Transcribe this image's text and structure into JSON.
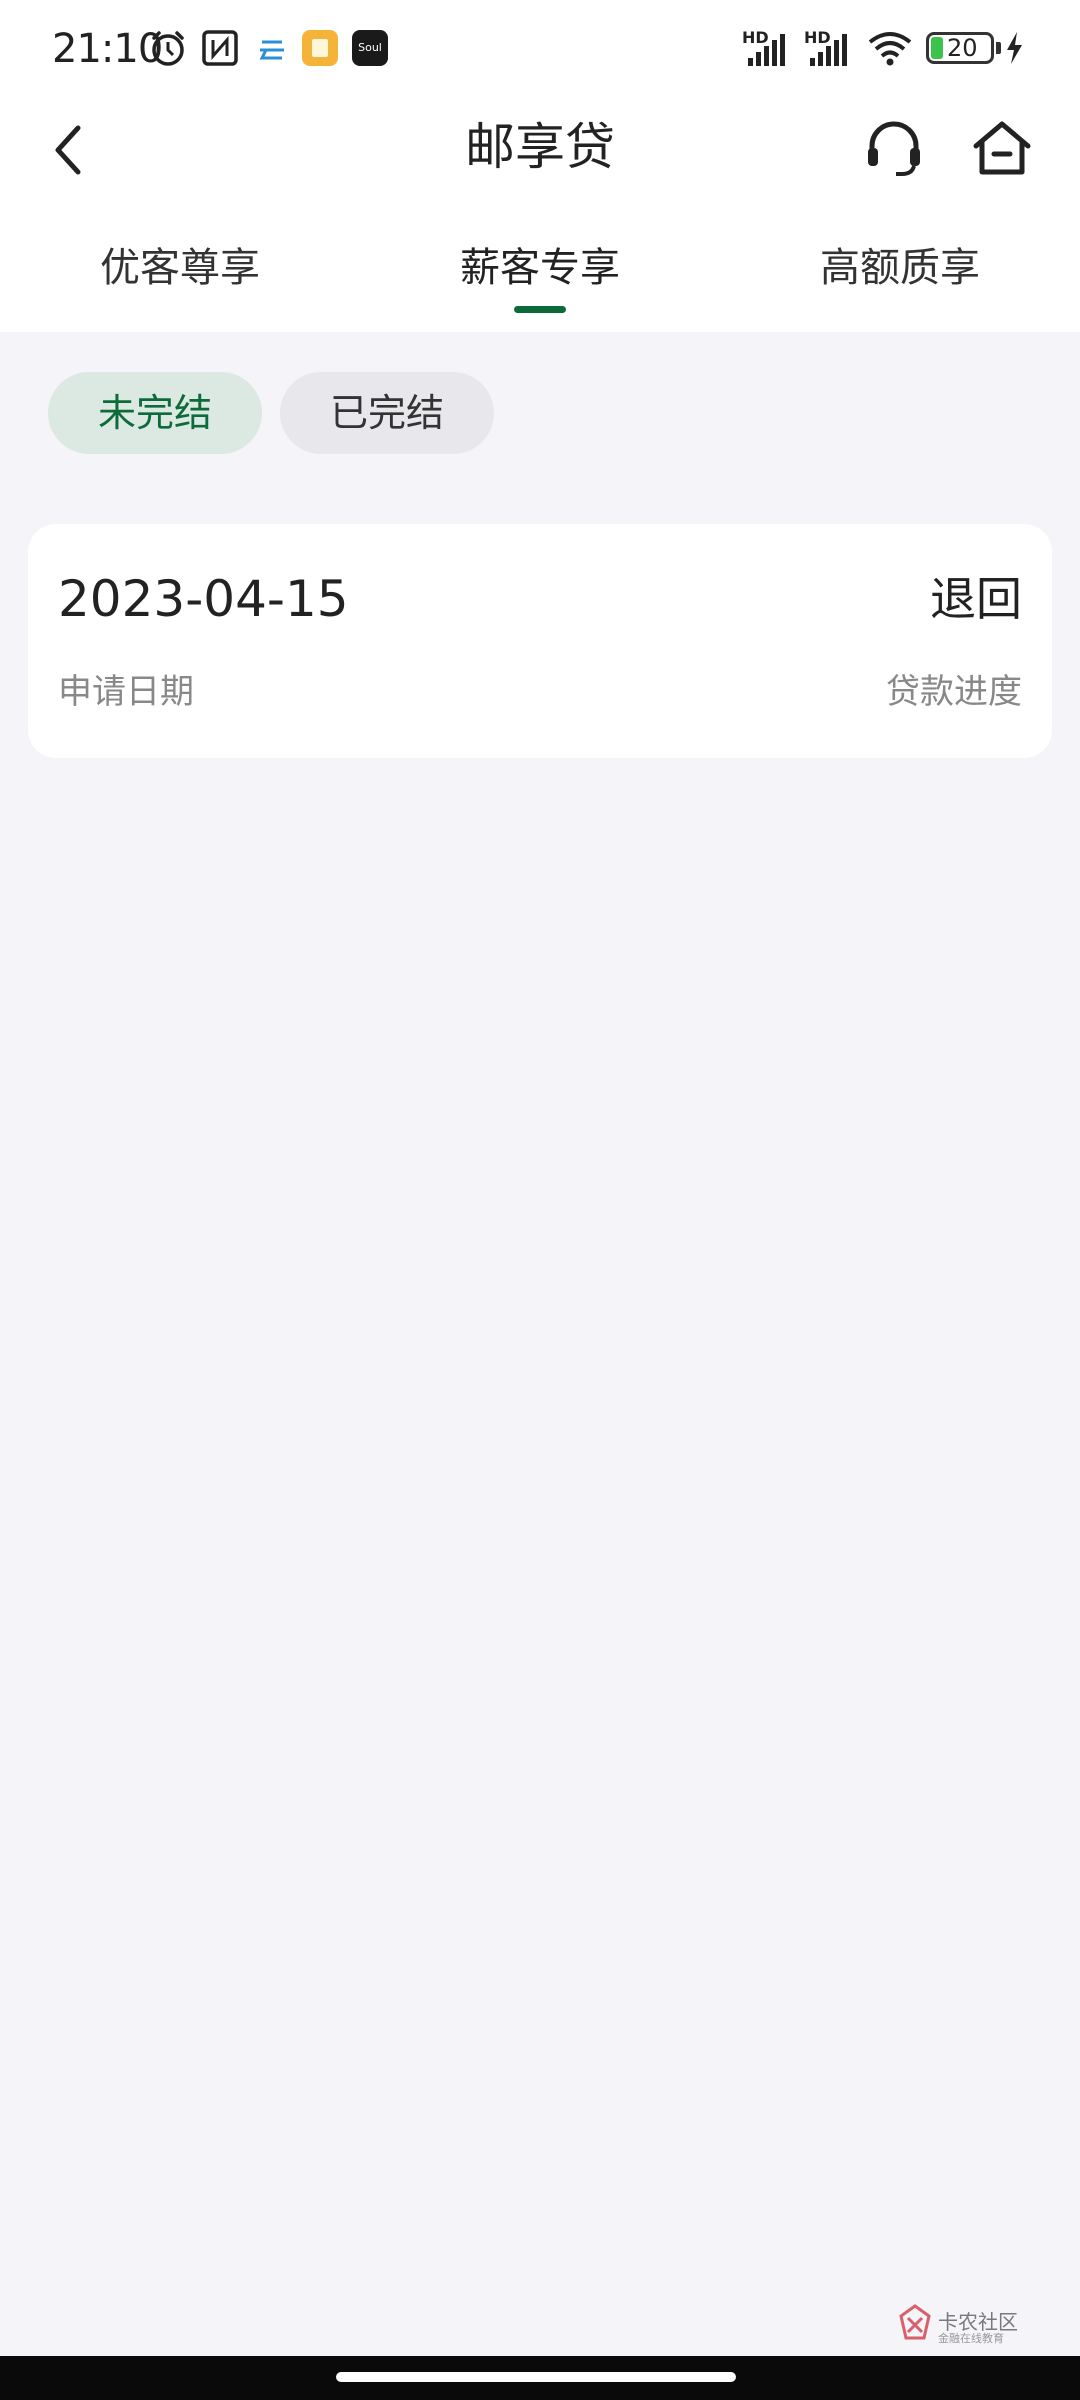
{
  "status_bar": {
    "time": "21:10",
    "hd1": "HD",
    "hd2": "HD",
    "battery": "20",
    "apps": [
      "alarm-icon",
      "nfc-icon",
      "cloud-app-icon",
      "notes-app-icon",
      "soul-app-icon"
    ],
    "soul_label": "Soul"
  },
  "header": {
    "title": "邮享贷",
    "back_icon": "chevron-left-icon",
    "service_icon": "headset-icon",
    "home_icon": "home-icon"
  },
  "tabs": [
    {
      "label": "优客尊享",
      "active": false
    },
    {
      "label": "薪客专享",
      "active": true
    },
    {
      "label": "高额质享",
      "active": false
    }
  ],
  "filters": {
    "unfinished": "未完结",
    "finished": "已完结",
    "selected": "未完结"
  },
  "records": [
    {
      "date": "2023-04-15",
      "date_label": "申请日期",
      "status": "退回",
      "status_label": "贷款进度"
    }
  ],
  "watermark": {
    "title": "卡农社区",
    "subtitle": "金融在线教育"
  },
  "colors": {
    "accent": "#0c6a3a",
    "chip_active_bg": "#dbe9e2",
    "page_bg": "#f4f4f9"
  }
}
